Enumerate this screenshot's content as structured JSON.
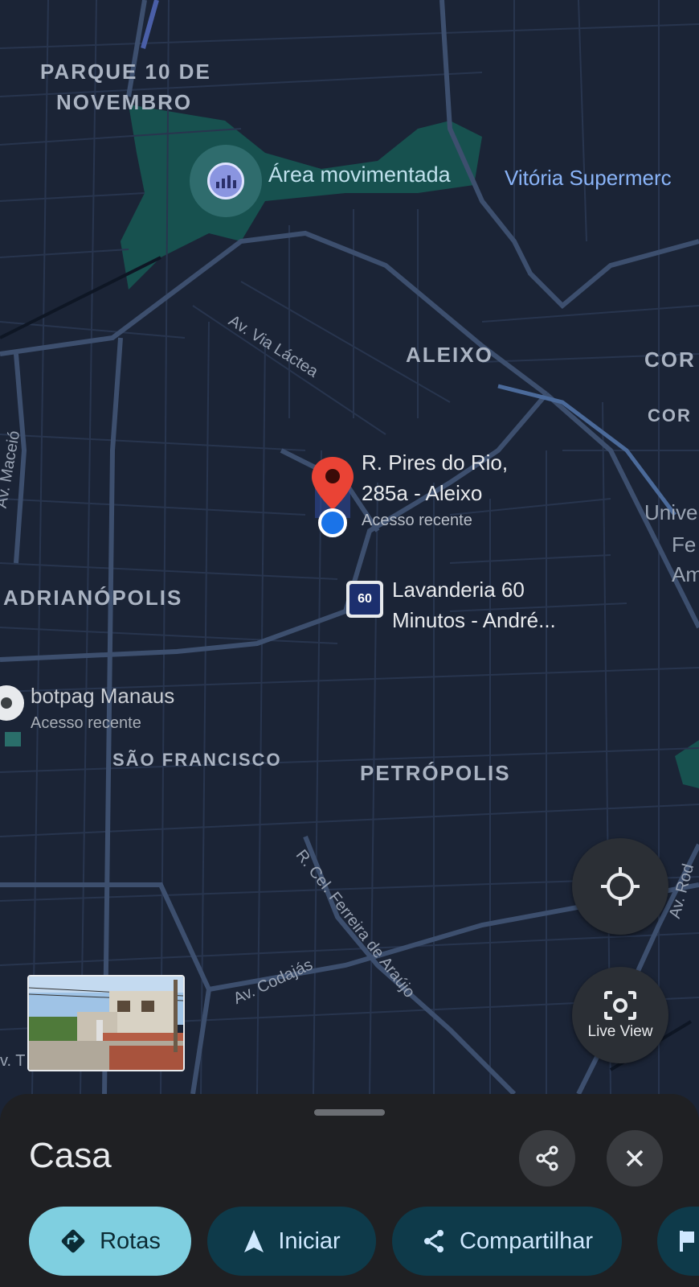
{
  "map": {
    "areas": {
      "parque_10_line1": "PARQUE 10 DE",
      "parque_10_line2": "NOVEMBRO",
      "aleixo": "ALEIXO",
      "cor1": "COR",
      "cor2": "COR",
      "adrianopolis": "ADRIANÓPOLIS",
      "sao_francisco": "SÃO FRANCISCO",
      "petropolis": "PETRÓPOLIS"
    },
    "streets": {
      "via_lactea": "Av. Via Láctea",
      "maceio": "Av. Maceió",
      "ferreira": "R. Cel. Ferreira de Araújo",
      "codajas": "Av. Codajás",
      "av_t": "v. T",
      "av_rod": "Av. Rod"
    },
    "busy_area": "Área movimentada",
    "store": "Vitória Supermerc",
    "univ": [
      "Unive",
      "Fe",
      "Am"
    ],
    "pin": {
      "title_line1": "R. Pires do Rio,",
      "title_line2": "285a - Aleixo",
      "subtitle": "Acesso recente"
    },
    "laundry": {
      "title_line1": "Lavanderia 60",
      "title_line2": "Minutos - André...",
      "logo_text": "60"
    },
    "botpag": {
      "title": "botpag Manaus",
      "subtitle": "Acesso recente"
    }
  },
  "buttons": {
    "live_view": "Live View",
    "my_location_icon": "crosshair-icon",
    "live_view_icon": "camera-scan-icon"
  },
  "sheet": {
    "title": "Casa",
    "share_icon": "share-icon",
    "close_icon": "close-icon",
    "chips": [
      {
        "label": "Rotas",
        "icon": "directions-icon"
      },
      {
        "label": "Iniciar",
        "icon": "navigation-arrow-icon"
      },
      {
        "label": "Compartilhar",
        "icon": "share-icon"
      },
      {
        "label": "",
        "icon": "flag-icon"
      }
    ]
  },
  "colors": {
    "map_bg": "#1b2436",
    "road": "#2f3f5a",
    "major_road": "#4a5d7e",
    "park": "#17514f",
    "pin_red": "#ea4335",
    "location_blue": "#4285f4",
    "chip_primary": "#7fcfe0"
  }
}
